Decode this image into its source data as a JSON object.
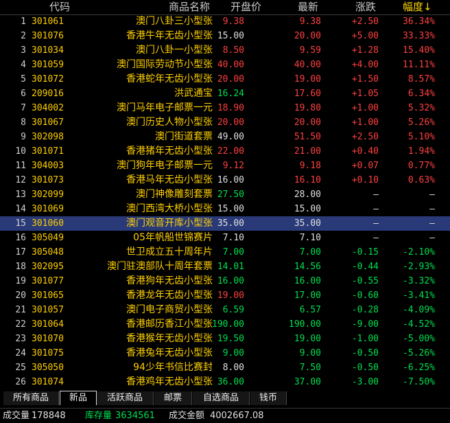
{
  "header": {
    "code": "代码",
    "name": "商品名称",
    "open": "开盘价",
    "last": "最新",
    "change": "涨跌",
    "pct": "幅度",
    "sort_arrow": "↓"
  },
  "selected_row": 15,
  "colors": {
    "up": "#ff4040",
    "down": "#00e050",
    "flat": "#e0e0e0",
    "code": "#ffd000",
    "selected_bg": "#2a3a78"
  },
  "rows": [
    {
      "idx": "1",
      "code": "301061",
      "name": "澳门八卦三小型张",
      "open": "9.38",
      "last": "9.38",
      "change": "+2.50",
      "pct": "36.34%"
    },
    {
      "idx": "2",
      "code": "301076",
      "name": "香港牛年无齿小型张",
      "open": "15.00",
      "last": "20.00",
      "change": "+5.00",
      "pct": "33.33%"
    },
    {
      "idx": "3",
      "code": "301034",
      "name": "澳门八卦一小型张",
      "open": "8.50",
      "last": "9.59",
      "change": "+1.28",
      "pct": "15.40%"
    },
    {
      "idx": "4",
      "code": "301059",
      "name": "澳门国际劳动节小型张",
      "open": "40.00",
      "last": "40.00",
      "change": "+4.00",
      "pct": "11.11%"
    },
    {
      "idx": "5",
      "code": "301072",
      "name": "香港蛇年无齿小型张",
      "open": "20.00",
      "last": "19.00",
      "change": "+1.50",
      "pct": "8.57%"
    },
    {
      "idx": "6",
      "code": "209016",
      "name": "洪武通宝",
      "open": "16.24",
      "last": "17.60",
      "change": "+1.05",
      "pct": "6.34%"
    },
    {
      "idx": "7",
      "code": "304002",
      "name": "澳门马年电子邮票一元",
      "open": "18.90",
      "last": "19.80",
      "change": "+1.00",
      "pct": "5.32%"
    },
    {
      "idx": "8",
      "code": "301067",
      "name": "澳门历史人物小型张",
      "open": "20.00",
      "last": "20.00",
      "change": "+1.00",
      "pct": "5.26%"
    },
    {
      "idx": "9",
      "code": "302098",
      "name": "澳门街道套票",
      "open": "49.00",
      "last": "51.50",
      "change": "+2.50",
      "pct": "5.10%"
    },
    {
      "idx": "10",
      "code": "301071",
      "name": "香港猪年无齿小型张",
      "open": "22.00",
      "last": "21.00",
      "change": "+0.40",
      "pct": "1.94%"
    },
    {
      "idx": "11",
      "code": "304003",
      "name": "澳门狗年电子邮票一元",
      "open": "9.12",
      "last": "9.18",
      "change": "+0.07",
      "pct": "0.77%"
    },
    {
      "idx": "12",
      "code": "301073",
      "name": "香港马年无齿小型张",
      "open": "16.00",
      "last": "16.10",
      "change": "+0.10",
      "pct": "0.63%"
    },
    {
      "idx": "13",
      "code": "302099",
      "name": "澳门神像雕刻套票",
      "open": "27.50",
      "last": "28.00",
      "change": "—",
      "pct": "—"
    },
    {
      "idx": "14",
      "code": "301069",
      "name": "澳门西湾大桥小型张",
      "open": "15.00",
      "last": "15.00",
      "change": "—",
      "pct": "—"
    },
    {
      "idx": "15",
      "code": "301060",
      "name": "澳门观音开库小型张",
      "open": "35.00",
      "last": "35.00",
      "change": "—",
      "pct": "—"
    },
    {
      "idx": "16",
      "code": "305049",
      "name": "05年帆船世锦赛片",
      "open": "7.10",
      "last": "7.10",
      "change": "—",
      "pct": "—"
    },
    {
      "idx": "17",
      "code": "305048",
      "name": "世卫成立五十周年片",
      "open": "7.00",
      "last": "7.00",
      "change": "-0.15",
      "pct": "-2.10%"
    },
    {
      "idx": "18",
      "code": "302095",
      "name": "澳门驻澳部队十周年套票",
      "open": "14.01",
      "last": "14.56",
      "change": "-0.44",
      "pct": "-2.93%"
    },
    {
      "idx": "19",
      "code": "301077",
      "name": "香港狗年无齿小型张",
      "open": "16.00",
      "last": "16.00",
      "change": "-0.55",
      "pct": "-3.32%"
    },
    {
      "idx": "20",
      "code": "301065",
      "name": "香港龙年无齿小型张",
      "open": "19.00",
      "last": "17.00",
      "change": "-0.60",
      "pct": "-3.41%"
    },
    {
      "idx": "21",
      "code": "301057",
      "name": "澳门电子商贸小型张",
      "open": "6.59",
      "last": "6.57",
      "change": "-0.28",
      "pct": "-4.09%"
    },
    {
      "idx": "22",
      "code": "301064",
      "name": "香港邮历香江小型张",
      "open": "190.00",
      "last": "190.00",
      "change": "-9.00",
      "pct": "-4.52%"
    },
    {
      "idx": "23",
      "code": "301070",
      "name": "香港猴年无齿小型张",
      "open": "19.50",
      "last": "19.00",
      "change": "-1.00",
      "pct": "-5.00%"
    },
    {
      "idx": "24",
      "code": "301075",
      "name": "香港兔年无齿小型张",
      "open": "9.00",
      "last": "9.00",
      "change": "-0.50",
      "pct": "-5.26%"
    },
    {
      "idx": "25",
      "code": "305050",
      "name": "94少年书信比赛封",
      "open": "8.00",
      "last": "7.50",
      "change": "-0.50",
      "pct": "-6.25%"
    },
    {
      "idx": "26",
      "code": "301074",
      "name": "香港鸡年无齿小型张",
      "open": "36.00",
      "last": "37.00",
      "change": "-3.00",
      "pct": "-7.50%"
    }
  ],
  "tabs": [
    {
      "label": "所有商品",
      "active": false
    },
    {
      "label": "新品",
      "active": true
    },
    {
      "label": "活跃商品",
      "active": false
    },
    {
      "label": "邮票",
      "active": false
    },
    {
      "label": "自选商品",
      "active": false
    },
    {
      "label": "钱币",
      "active": false
    }
  ],
  "status": {
    "volume_label": "成交量",
    "volume_value": "178848",
    "stock_label": "库存量",
    "stock_value": "3634561",
    "amount_label": "成交金额",
    "amount_value": "4002667.08"
  }
}
